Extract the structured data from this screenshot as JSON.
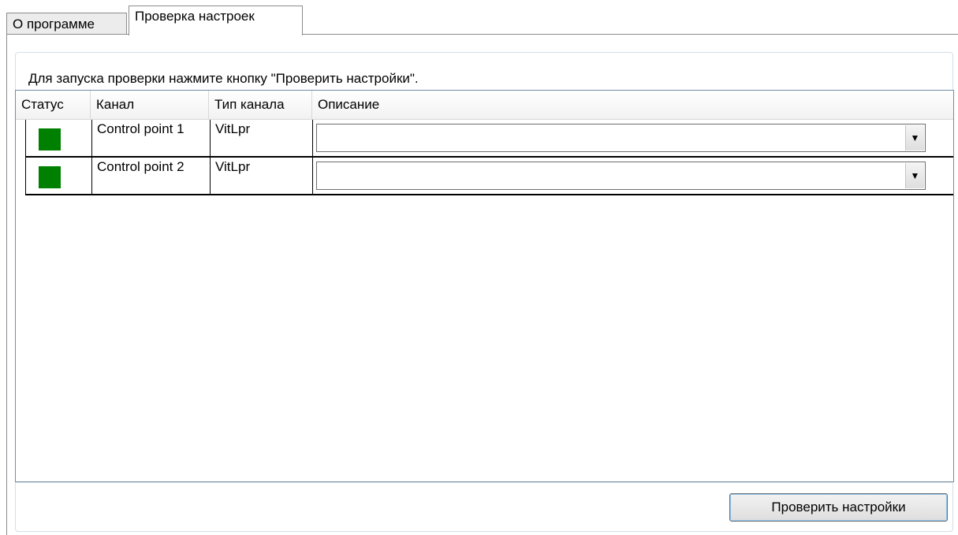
{
  "tabs": [
    {
      "label": "О программе"
    },
    {
      "label": "Проверка настроек"
    }
  ],
  "hint": "Для запуска проверки нажмите кнопку \"Проверить настройки\".",
  "table": {
    "columns": [
      "Статус",
      "Канал",
      "Тип канала",
      "Описание"
    ],
    "rows": [
      {
        "status_color": "#008000",
        "channel": "Control point 1",
        "type": "VitLpr",
        "description": ""
      },
      {
        "status_color": "#008000",
        "channel": "Control point 2",
        "type": "VitLpr",
        "description": ""
      }
    ]
  },
  "check_button": "Проверить настройки",
  "icons": {
    "dropdown": "chevron-down-icon"
  }
}
